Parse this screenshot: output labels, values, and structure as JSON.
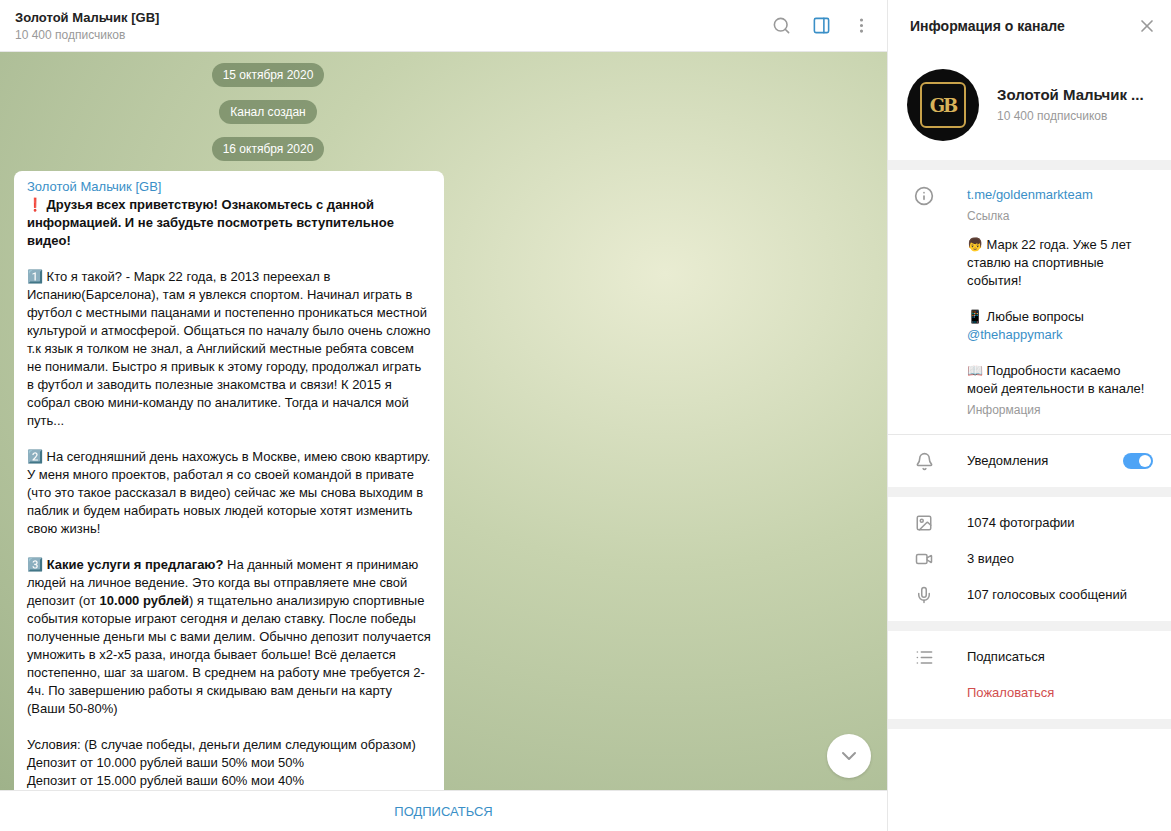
{
  "chat": {
    "title": "Золотой Мальчик [GB]",
    "subtitle": "10 400 подписчиков",
    "info_panel_open": true,
    "service_messages": [
      {
        "text": "15 октября 2020"
      },
      {
        "text": "Канал создан"
      },
      {
        "text": "16 октября 2020"
      }
    ],
    "message": {
      "sender": "Золотой Мальчик [GB]",
      "paragraphs": [
        [
          [
            {
              "text": "❗ Друзья всех приветствую! Ознакомьтесь с данной информацией. И не забудьте посмотреть вступительное видео!",
              "bold": true
            }
          ]
        ],
        [
          [
            {
              "text": "1️⃣ Кто я такой? - Марк 22 года, в 2013 переехал в Испанию(Барселона), там я увлекся спортом. Начинал играть в футбол с местными пацанами и постепенно проникаться местной  культурой и атмосферой. Общаться по началу было очень сложно т.к язык я толком не знал, а Английский местные ребята совсем не понимали. Быстро я привык к этому городу, продолжал играть в футбол и заводить полезные знакомства и связи! К 2015 я собрал свою мини-команду по аналитике. Тогда и начался мой путь...",
              "bold": false
            }
          ]
        ],
        [
          [
            {
              "text": "2️⃣ На сегодняшний день нахожусь в Москве, имею свою квартиру. У меня много проектов, работал я со своей командой в привате (что это такое рассказал в видео) сейчас же мы снова выходим в паблик и будем набирать новых людей которые хотят изменить свою жизнь!",
              "bold": false
            }
          ]
        ],
        [
          [
            {
              "text": "3️⃣ ",
              "bold": false
            },
            {
              "text": "Какие услуги я предлагаю?",
              "bold": true
            },
            {
              "text": " На данный момент я принимаю людей на личное ведение. Это когда вы отправляете мне свой депозит (от ",
              "bold": false
            },
            {
              "text": "10.000 рублей",
              "bold": true
            },
            {
              "text": ") я тщательно анализирую спортивные события которые играют сегодня и делаю ставку. После победы полученные деньги мы с вами делим. Обычно депозит получается умножить в x2-x5 раза, иногда бывает больше! Всё делается постепенно, шаг за шагом. В среднем на работу мне требуется 2-4ч. По завершению работы я скидываю вам деньги на карту (Ваши 50-80%)",
              "bold": false
            }
          ]
        ],
        [
          [
            {
              "text": "Условия: (В случае победы, деньги делим следующим образом)",
              "bold": false
            }
          ],
          [
            {
              "text": "Депозит от 10.000 рублей ваши 50% мои 50%",
              "bold": false
            }
          ],
          [
            {
              "text": "Депозит от 15.000 рублей ваши 60% мои 40%",
              "bold": false
            }
          ]
        ]
      ]
    },
    "subscribe_button": "ПОДПИСАТЬСЯ"
  },
  "info_panel": {
    "title": "Информация о канале",
    "name": "Золотой Мальчик ...",
    "subscribers": "10 400 подписчиков",
    "logo": "GB",
    "link": {
      "value": "t.me/goldenmarkteam",
      "label": "Ссылка"
    },
    "description": {
      "paragraphs": [
        [
          {
            "text": "👦 Марк 22 года. Уже 5 лет ставлю на спортивные события!",
            "link": false
          }
        ],
        [
          {
            "text": "📱 Любые вопросы ",
            "link": false
          },
          {
            "text": "@thehappymark",
            "link": true
          }
        ],
        [
          {
            "text": "📖 Подробности касаемо моей деятельности в канале!",
            "link": false
          }
        ]
      ],
      "label": "Информация"
    },
    "notifications": {
      "label": "Уведомления",
      "on": true
    },
    "media": [
      {
        "label": "1074 фотографии",
        "kind": "photo"
      },
      {
        "label": "3 видео",
        "kind": "video"
      },
      {
        "label": "107 голосовых сообщений",
        "kind": "voice"
      }
    ],
    "actions": [
      {
        "label": "Подписаться",
        "kind": "subscribe"
      },
      {
        "label": "Пожаловаться",
        "kind": "report"
      }
    ]
  }
}
